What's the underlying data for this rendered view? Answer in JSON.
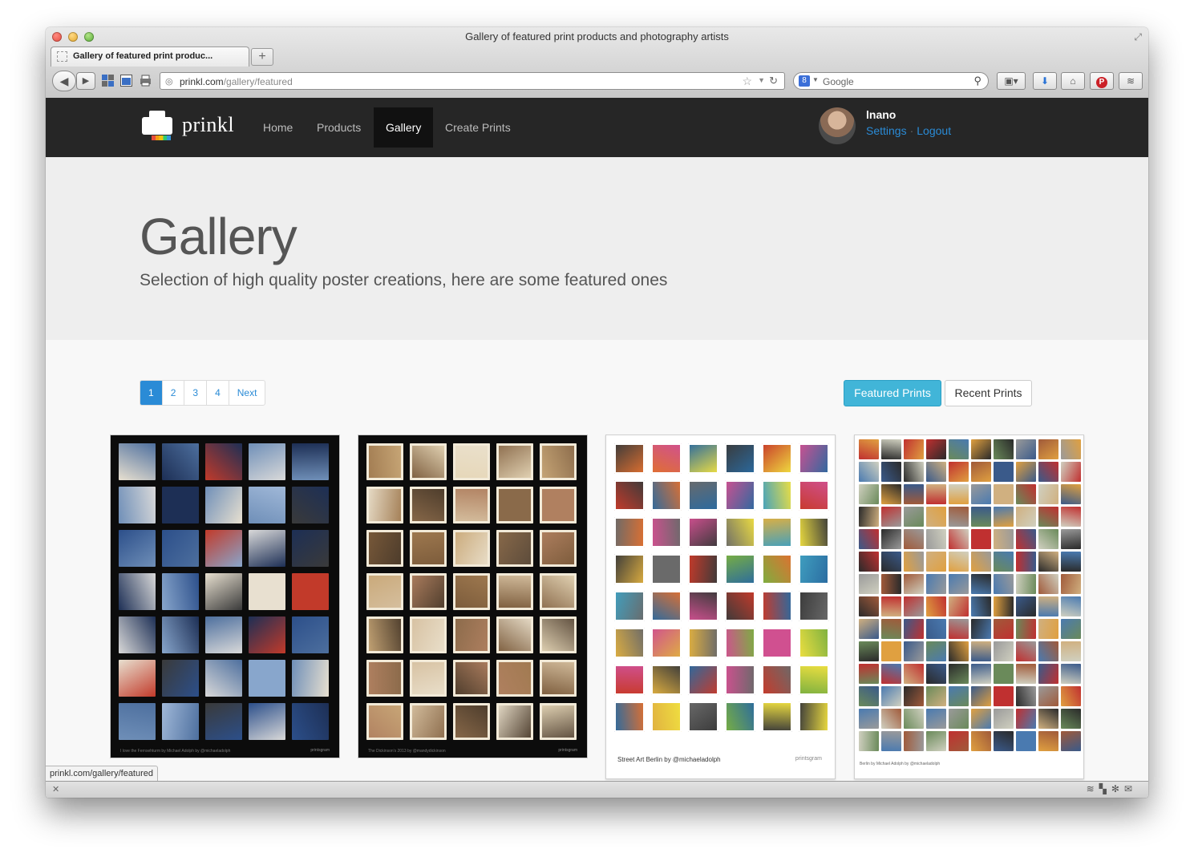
{
  "window": {
    "title": "Gallery of featured print products and photography artists",
    "tab_title": "Gallery of featured print produc..."
  },
  "browser": {
    "url_domain": "prinkl.com",
    "url_path": "/gallery/featured",
    "search_placeholder": "Google",
    "status_url": "prinkl.com/gallery/featured",
    "search_engine_letter": "8"
  },
  "site": {
    "logo_text": "prinkl",
    "nav": [
      {
        "label": "Home"
      },
      {
        "label": "Products"
      },
      {
        "label": "Gallery",
        "active": true
      },
      {
        "label": "Create Prints"
      }
    ],
    "user": {
      "name": "lnano",
      "settings_label": "Settings",
      "separator": "·",
      "logout_label": "Logout"
    }
  },
  "hero": {
    "title": "Gallery",
    "subtitle": "Selection of high quality poster creations, here are some featured ones"
  },
  "pagination": {
    "pages": [
      "1",
      "2",
      "3",
      "4"
    ],
    "current": "1",
    "next_label": "Next"
  },
  "filters": {
    "featured_label": "Featured Prints",
    "recent_label": "Recent Prints"
  },
  "posters": [
    {
      "caption": "I love the Fernsehturm by Michael Adolph by @michaeladolph",
      "brand": "printsgram"
    },
    {
      "caption": "The Dickinson's 2013 by @mandydickinson",
      "brand": "printsgram"
    },
    {
      "caption": "Street Art Berlin by @michaeladolph",
      "brand": "printsgram"
    },
    {
      "caption": "Berlin by Michael Adolph by @michaeladolph",
      "brand": ""
    }
  ],
  "colors": {
    "header_bg": "#262626",
    "accent_blue": "#2a8bd6",
    "featured_button": "#41b5d8",
    "hero_bg": "#eeeeee"
  }
}
